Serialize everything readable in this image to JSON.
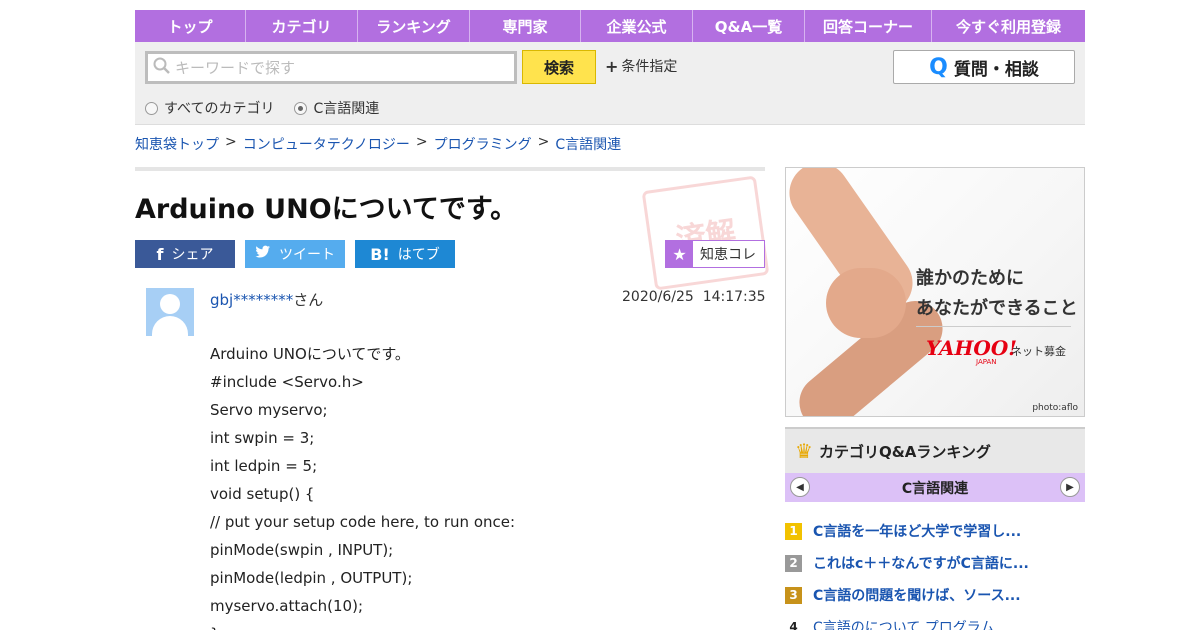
{
  "nav": {
    "items": [
      "トップ",
      "カテゴリ",
      "ランキング",
      "専門家",
      "企業公式",
      "Q&A一覧",
      "回答コーナー",
      "今すぐ利用登録"
    ]
  },
  "search": {
    "placeholder": "キーワードで探す",
    "button_label": "検索",
    "conditions_label": "条件指定",
    "ask_label": "質問・相談",
    "ask_icon": "Q",
    "scope_options": [
      "すべてのカテゴリ",
      "C言語関連"
    ],
    "scope_selected": "C言語関連"
  },
  "breadcrumb": {
    "items": [
      "知恵袋トップ",
      "コンピュータテクノロジー",
      "プログラミング",
      "C言語関連"
    ],
    "separator": ">"
  },
  "question": {
    "title": "Arduino UNOについてです。",
    "stamp": "済解",
    "share_facebook": "シェア",
    "share_twitter": "ツイート",
    "share_hatena": "はてブ",
    "hatena_icon": "B!",
    "chiekore_label": "知恵コレ",
    "user_id": "gbj********",
    "user_suffix": "さん",
    "date": "2020/6/25",
    "time": "14:17:35",
    "body_lines": [
      "Arduino UNOについてです。",
      "#include <Servo.h>",
      "Servo myservo;",
      "int swpin = 3;",
      "int ledpin = 5;",
      "void setup() {",
      "// put your setup code here, to run once:",
      "pinMode(swpin , INPUT);",
      "pinMode(ledpin , OUTPUT);",
      "myservo.attach(10);",
      "}"
    ]
  },
  "ad": {
    "line1": "誰かのために",
    "line2": "あなたができること",
    "brand": "YAHOO!",
    "brand_sub": "JAPAN",
    "service": "ネット募金",
    "credit": "photo:aflo"
  },
  "ranking": {
    "title": "カテゴリQ&Aランキング",
    "category": "C言語関連",
    "items": [
      {
        "rank": "1",
        "text": "C言語を一年ほど大学で学習し..."
      },
      {
        "rank": "2",
        "text": "これはc＋＋なんですがC言語に..."
      },
      {
        "rank": "3",
        "text": "C言語の問題を聞けば、ソース..."
      },
      {
        "rank": "4",
        "text": "C言語のについて プログラム..."
      }
    ]
  },
  "colors": {
    "nav_purple": "#b26fe0",
    "search_button": "#ffe34d",
    "link_blue": "#1a55b0",
    "facebook": "#3a5998",
    "twitter": "#55acee",
    "hatena": "#1e88d4"
  }
}
